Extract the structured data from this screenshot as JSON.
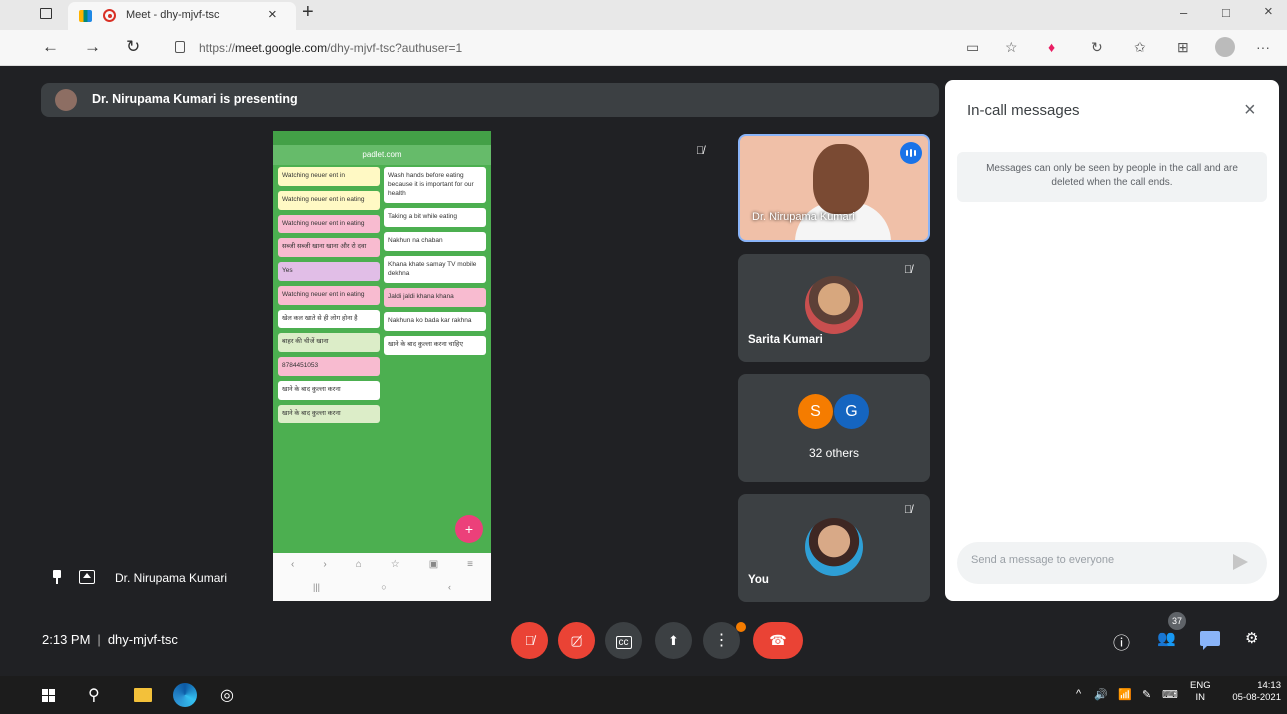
{
  "browser": {
    "tab_title": "Meet - dhy-mjvf-tsc",
    "tab_close": "×",
    "new_tab": "+",
    "url_prefix": "https://",
    "url_host": "meet.google.com",
    "url_path": "/dhy-mjvf-tsc?authuser=1",
    "nav_back": "←",
    "nav_forward": "→",
    "nav_reload": "↻",
    "win_minimize": "–",
    "win_maximize": "□",
    "win_close": "×",
    "more_menu": "···"
  },
  "presenting": {
    "text": "Dr. Nirupama Kumari is presenting"
  },
  "shared_screen": {
    "url": "padlet.com",
    "col1_cards": [
      {
        "text": "Watching neuer ent in",
        "style": "yel"
      },
      {
        "text": "Watching neuer ent in eating",
        "style": "yel"
      },
      {
        "text": "Watching neuer ent in eating",
        "style": "pink"
      },
      {
        "text": "सब्जी सब्जी खाना खाना और रो दवा",
        "style": "pink"
      },
      {
        "text": "Yes",
        "style": "lav"
      },
      {
        "text": "Watching neuer ent in eating",
        "style": "pink"
      },
      {
        "text": "खेल कल खाते से ही लोग होना है",
        "style": "white"
      },
      {
        "text": "बाहर की चीजें खाना",
        "style": "lg"
      },
      {
        "text": "8784451053",
        "style": "pink"
      },
      {
        "text": "खाने के बाद कुल्ला करना",
        "style": "white"
      },
      {
        "text": "खाने के बाद कुल्ला करना",
        "style": "lg"
      }
    ],
    "col2_cards": [
      {
        "text": "Wash hands before eating because it is important for our health",
        "style": "white"
      },
      {
        "text": "Taking a bit while eating",
        "style": "white"
      },
      {
        "text": "Nakhun na chaban",
        "style": "white"
      },
      {
        "text": "Khana khate samay TV mobile dekhna",
        "style": "white"
      },
      {
        "text": "Jaldi jaldi khana khana",
        "style": "pink"
      },
      {
        "text": "Nakhuna ko bada kar rakhna",
        "style": "white"
      },
      {
        "text": "खाने के बाद कुल्ला करना चाहिए",
        "style": "white"
      }
    ],
    "fab": "+"
  },
  "pinned": {
    "name": "Dr. Nirupama Kumari"
  },
  "tiles": {
    "speaker_name": "Dr. Nirupama Kumari",
    "participant2": "Sarita Kumari",
    "others_initial_1": "S",
    "others_initial_2": "G",
    "others_label": "32 others",
    "self_label": "You"
  },
  "chat": {
    "title": "In-call messages",
    "close": "×",
    "info": "Messages can only be seen by people in the call and are deleted when the call ends.",
    "placeholder": "Send a message to everyone"
  },
  "controls": {
    "time": "2:13 PM",
    "separator": "|",
    "meeting_code": "dhy-mjvf-tsc",
    "participants_count": "37",
    "info_icon": "ⓘ",
    "people_icon": "👥",
    "activities_icon": "⚙"
  },
  "taskbar": {
    "lang_1": "ENG",
    "lang_2": "IN",
    "time": "14:13",
    "date": "05-08-2021",
    "tray_chevron": "^",
    "tray_volume": "🔊",
    "tray_network": "📶"
  },
  "colors": {
    "accent_blue": "#1a73e8",
    "meet_red": "#ea4335",
    "dark_bg": "#202124",
    "tile_bg": "#3c4043",
    "padlet_green": "#4caf50"
  }
}
